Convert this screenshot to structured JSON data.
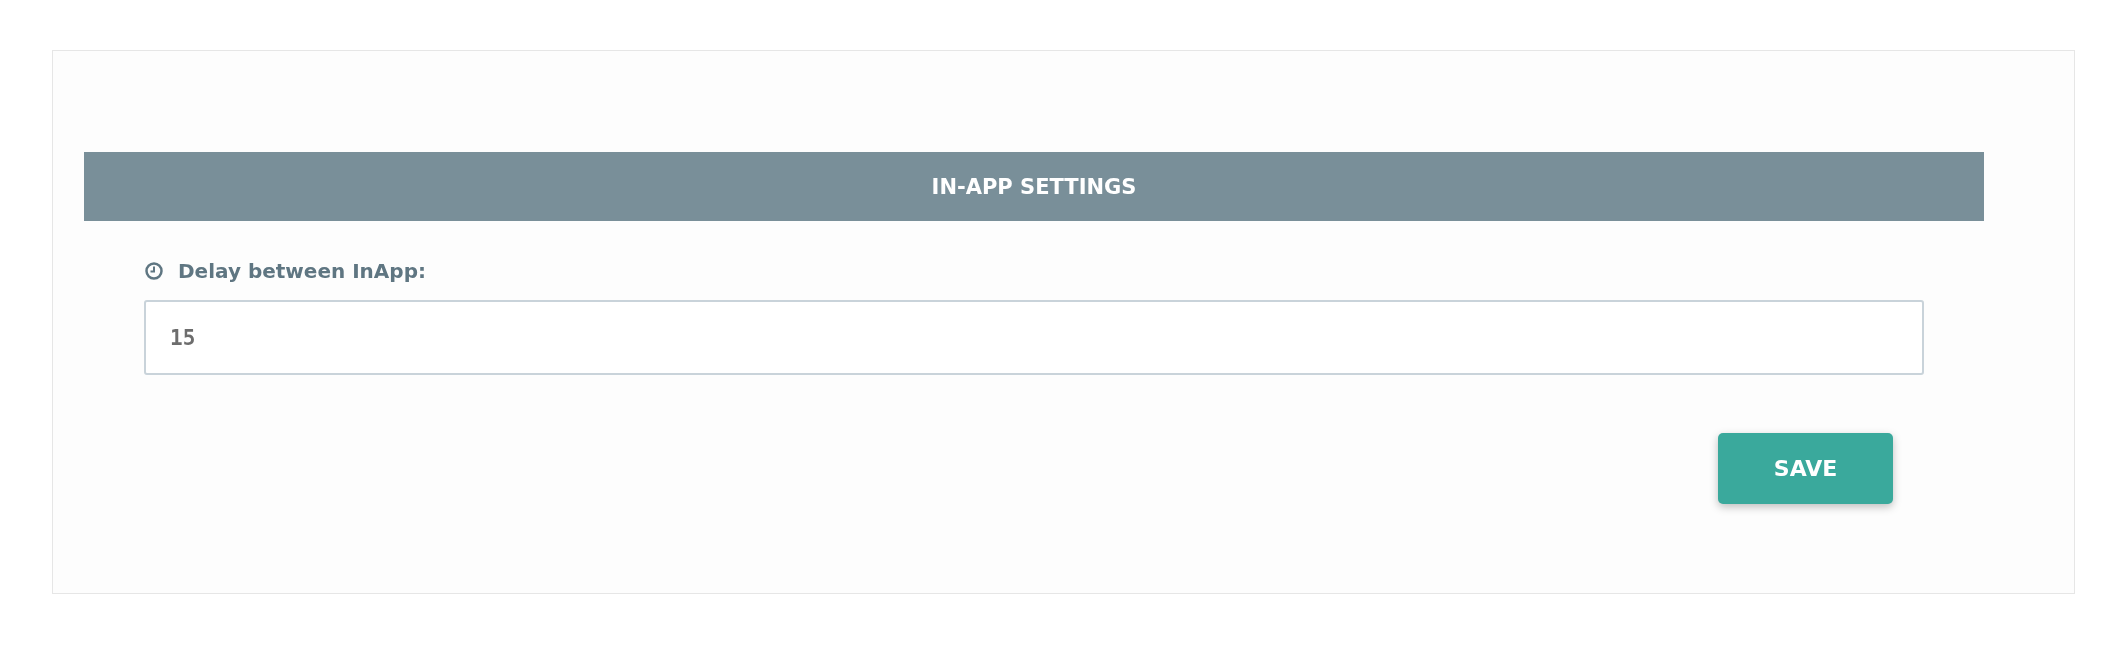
{
  "panel": {
    "title": "IN-APP SETTINGS"
  },
  "field": {
    "label": "Delay between InApp:",
    "value": "15"
  },
  "buttons": [
    {
      "label": "SAVE"
    }
  ]
}
